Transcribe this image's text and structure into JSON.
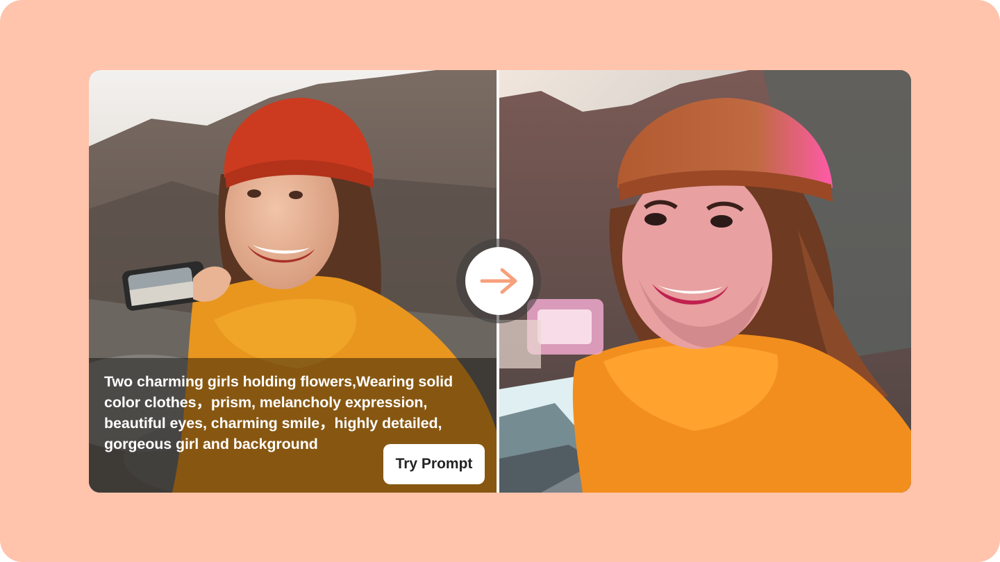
{
  "card": {
    "prompt_text": "Two charming girls holding flowers,Wearing solid color clothes，prism, melancholy expression, beautiful eyes, charming smile，highly detailed, gorgeous girl and background",
    "try_button_label": "Try Prompt"
  },
  "icons": {
    "arrow": "arrow-right-icon"
  },
  "colors": {
    "page_background": "#ffc4ab",
    "arrow_accent": "#f7a07c",
    "button_background": "#ffffff",
    "caption_overlay": "rgba(0,0,0,0.42)"
  }
}
